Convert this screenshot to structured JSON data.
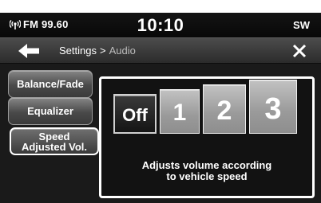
{
  "status": {
    "radio": "FM 99.60",
    "clock": "10:10",
    "compass": "SW"
  },
  "nav": {
    "breadcrumb_parent": "Settings",
    "breadcrumb_separator": ">",
    "breadcrumb_current": "Audio"
  },
  "sidebar": {
    "items": [
      {
        "label": "Balance/Fade",
        "active": false
      },
      {
        "label": "Equalizer",
        "active": false
      },
      {
        "label_line1": "Speed",
        "label_line2": "Adjusted Vol.",
        "active": true
      }
    ]
  },
  "panel": {
    "options": [
      {
        "label": "Off",
        "selected": true
      },
      {
        "label": "1",
        "selected": false
      },
      {
        "label": "2",
        "selected": false
      },
      {
        "label": "3",
        "selected": false
      }
    ],
    "description_line1": "Adjusts volume according",
    "description_line2": "to vehicle speed"
  }
}
